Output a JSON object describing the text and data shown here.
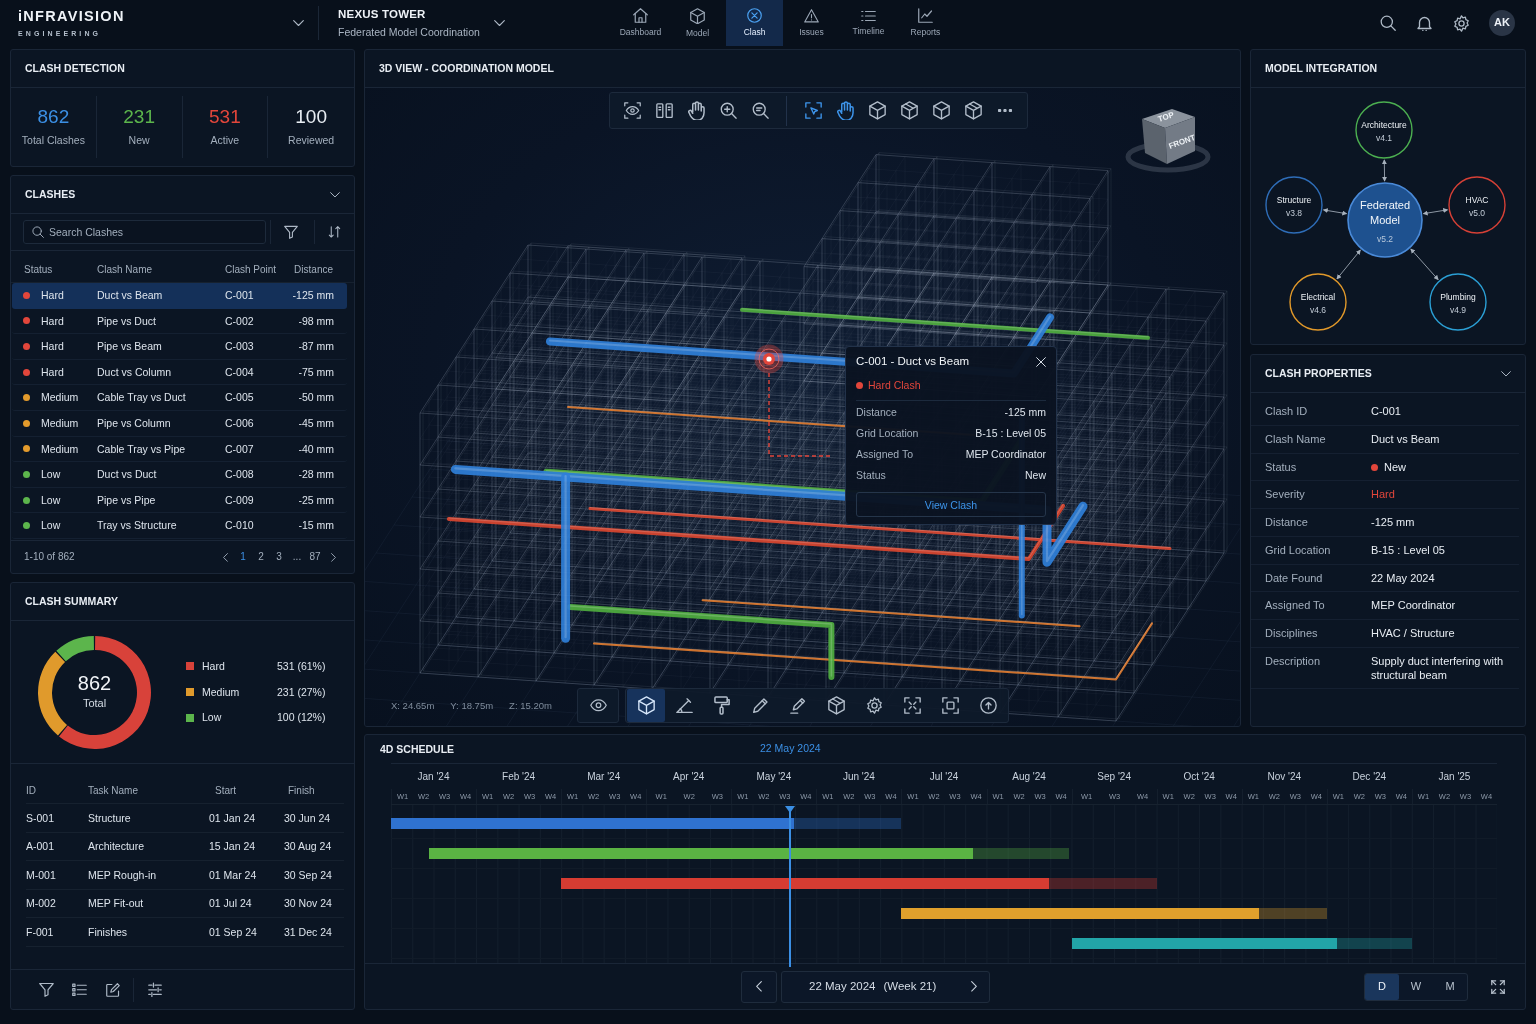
{
  "header": {
    "brand": "iNFRAVISION",
    "tagline": "ENGINEERING",
    "project": {
      "name": "NEXUS TOWER",
      "subtitle": "Federated Model Coordination"
    },
    "nav": [
      {
        "label": "Dashboard",
        "selected": false
      },
      {
        "label": "Model",
        "selected": false
      },
      {
        "label": "Clash",
        "selected": true
      },
      {
        "label": "Issues",
        "selected": false
      },
      {
        "label": "Timeline",
        "selected": false
      },
      {
        "label": "Reports",
        "selected": false
      }
    ],
    "avatar": "AK"
  },
  "clash_detection": {
    "title": "CLASH DETECTION",
    "stats": [
      {
        "value": "862",
        "label": "Total Clashes",
        "color": "#3b8fe4"
      },
      {
        "value": "231",
        "label": "New",
        "color": "#5cb54c"
      },
      {
        "value": "531",
        "label": "Active",
        "color": "#e2463b"
      },
      {
        "value": "100",
        "label": "Reviewed",
        "color": "#e8edf3"
      }
    ]
  },
  "clashes": {
    "title": "CLASHES",
    "search": {
      "placeholder": "Search Clashes"
    },
    "columns": [
      "Status",
      "Clash Name",
      "Clash Point",
      "Distance"
    ],
    "rows": [
      {
        "status": "Hard",
        "color": "#e2463b",
        "name": "Duct vs Beam",
        "point": "C-001",
        "distance": "-125 mm",
        "selected": true
      },
      {
        "status": "Hard",
        "color": "#e2463b",
        "name": "Pipe vs Duct",
        "point": "C-002",
        "distance": "-98 mm",
        "selected": false
      },
      {
        "status": "Hard",
        "color": "#e2463b",
        "name": "Pipe vs Beam",
        "point": "C-003",
        "distance": "-87 mm",
        "selected": false
      },
      {
        "status": "Hard",
        "color": "#e2463b",
        "name": "Duct vs Column",
        "point": "C-004",
        "distance": "-75 mm",
        "selected": false
      },
      {
        "status": "Medium",
        "color": "#e39b2c",
        "name": "Cable Tray vs Duct",
        "point": "C-005",
        "distance": "-50 mm",
        "selected": false
      },
      {
        "status": "Medium",
        "color": "#e39b2c",
        "name": "Pipe vs Column",
        "point": "C-006",
        "distance": "-45 mm",
        "selected": false
      },
      {
        "status": "Medium",
        "color": "#e39b2c",
        "name": "Cable Tray vs Pipe",
        "point": "C-007",
        "distance": "-40 mm",
        "selected": false
      },
      {
        "status": "Low",
        "color": "#5cb54c",
        "name": "Duct vs Duct",
        "point": "C-008",
        "distance": "-28 mm",
        "selected": false
      },
      {
        "status": "Low",
        "color": "#5cb54c",
        "name": "Pipe vs Pipe",
        "point": "C-009",
        "distance": "-25 mm",
        "selected": false
      },
      {
        "status": "Low",
        "color": "#5cb54c",
        "name": "Tray vs Structure",
        "point": "C-010",
        "distance": "-15 mm",
        "selected": false
      }
    ],
    "pagination": {
      "summary": "1-10 of 862",
      "pages": [
        {
          "label": "1",
          "selected": true
        },
        {
          "label": "2",
          "selected": false
        },
        {
          "label": "3",
          "selected": false
        },
        {
          "label": "...",
          "selected": false
        },
        {
          "label": "87",
          "selected": false
        }
      ]
    }
  },
  "clash_summary": {
    "title": "CLASH SUMMARY",
    "total": "862",
    "total_label": "Total",
    "chart_data": {
      "type": "donut",
      "categories": [
        "Hard",
        "Medium",
        "Low"
      ],
      "values": [
        61,
        27,
        12
      ]
    },
    "legend": [
      {
        "value": "531 (61%)",
        "color": "#d8423a"
      },
      {
        "value": "231 (27%)",
        "color": "#e09a2c"
      },
      {
        "value": "100 (12%)",
        "color": "#5cb54c"
      }
    ],
    "tasks": {
      "columns": [
        "ID",
        "Task Name",
        "Start",
        "Finish"
      ],
      "rows": [
        {
          "id": "S-001",
          "name": "Structure",
          "start": "01 Jan 24",
          "finish": "30 Jun 24"
        },
        {
          "id": "A-001",
          "name": "Architecture",
          "start": "15 Jan 24",
          "finish": "30 Aug 24"
        },
        {
          "id": "M-001",
          "name": "MEP Rough-in",
          "start": "01 Mar 24",
          "finish": "30 Sep 24"
        },
        {
          "id": "M-002",
          "name": "MEP Fit-out",
          "start": "01 Jul 24",
          "finish": "30 Nov 24"
        },
        {
          "id": "F-001",
          "name": "Finishes",
          "start": "01 Sep 24",
          "finish": "31 Dec 24"
        }
      ]
    }
  },
  "viewport": {
    "title": "3D VIEW - COORDINATION MODEL",
    "top_tools": [
      {
        "selected": false
      },
      {
        "selected": false
      },
      {
        "selected": false
      },
      {
        "selected": false
      },
      {
        "selected": false
      },
      {
        "selected": true
      },
      {
        "selected": true
      },
      {
        "selected": false
      },
      {
        "selected": false
      },
      {
        "selected": false
      },
      {
        "selected": false
      },
      {
        "selected": false
      }
    ],
    "view_cube": {
      "front": "FRONT",
      "top": "TOP"
    },
    "tooltip": {
      "title": "C-001 - Duct vs Beam",
      "severity": "Hard Clash",
      "color": "#e2463b",
      "rows": [
        {
          "label": "Distance",
          "value": "-125 mm"
        },
        {
          "label": "Grid Location",
          "value": "B-15 : Level 05"
        },
        {
          "label": "Assigned To",
          "value": "MEP Coordinator"
        },
        {
          "label": "Status",
          "value": "New"
        }
      ],
      "button": "View Clash"
    },
    "coordinates": [
      "X: 24.65m",
      "Y: 18.75m",
      "Z: 15.20m"
    ],
    "bottom_tools": [
      {
        "selected": false
      },
      {
        "selected": true
      },
      {
        "selected": false
      },
      {
        "selected": false
      },
      {
        "selected": false
      },
      {
        "selected": false
      },
      {
        "selected": false
      },
      {
        "selected": false
      },
      {
        "selected": false
      },
      {
        "selected": false
      },
      {
        "selected": false
      }
    ]
  },
  "model_integration": {
    "title": "MODEL INTEGRATION",
    "hub": {
      "name": "Federated Model",
      "version": "v5.2",
      "color": "#1e518f"
    },
    "nodes": [
      {
        "name": "Architecture",
        "version": "v4.1",
        "color": "#4caf50"
      },
      {
        "name": "Structure",
        "version": "v3.8",
        "color": "#2e6db8"
      },
      {
        "name": "HVAC",
        "version": "v5.0",
        "color": "#d64036"
      },
      {
        "name": "Electrical",
        "version": "v4.6",
        "color": "#e0982a"
      },
      {
        "name": "Plumbing",
        "version": "v4.9",
        "color": "#2b9fd4"
      }
    ]
  },
  "clash_properties": {
    "title": "CLASH PROPERTIES",
    "rows": [
      {
        "kind": "text",
        "label": "Clash ID",
        "value": "C-001"
      },
      {
        "kind": "text",
        "label": "Clash Name",
        "value": "Duct vs Beam"
      },
      {
        "kind": "status",
        "label": "Status",
        "value": "New",
        "color": "#e2463b"
      },
      {
        "kind": "severity",
        "label": "Severity",
        "value": "Hard",
        "color": "#e2463b"
      },
      {
        "kind": "text",
        "label": "Distance",
        "value": "-125 mm"
      },
      {
        "kind": "text",
        "label": "Grid Location",
        "value": "B-15 : Level 05"
      },
      {
        "kind": "text",
        "label": "Date Found",
        "value": "22 May 2024"
      },
      {
        "kind": "text",
        "label": "Assigned To",
        "value": "MEP Coordinator"
      },
      {
        "kind": "text",
        "label": "Disciplines",
        "value": "HVAC / Structure"
      },
      {
        "kind": "text",
        "label": "Description",
        "value": "Supply duct interfering with structural beam"
      }
    ]
  },
  "schedule": {
    "title": "4D SCHEDULE",
    "today": "22 May 2024",
    "months": [
      {
        "label": "Jan '24",
        "weeks": [
          "W1",
          "W2",
          "W3",
          "W4"
        ]
      },
      {
        "label": "Feb '24",
        "weeks": [
          "W1",
          "W2",
          "W3",
          "W4"
        ]
      },
      {
        "label": "Mar '24",
        "weeks": [
          "W1",
          "W2",
          "W3",
          "W4"
        ]
      },
      {
        "label": "Apr '24",
        "weeks": [
          "W1",
          "W2",
          "W3"
        ]
      },
      {
        "label": "May '24",
        "weeks": [
          "W1",
          "W2",
          "W3",
          "W4"
        ]
      },
      {
        "label": "Jun '24",
        "weeks": [
          "W1",
          "W2",
          "W3",
          "W4"
        ]
      },
      {
        "label": "Jul '24",
        "weeks": [
          "W1",
          "W2",
          "W3",
          "W4"
        ]
      },
      {
        "label": "Aug '24",
        "weeks": [
          "W1",
          "W2",
          "W3",
          "W4"
        ]
      },
      {
        "label": "Sep '24",
        "weeks": [
          "W1",
          "W3",
          "W4"
        ]
      },
      {
        "label": "Oct '24",
        "weeks": [
          "W1",
          "W2",
          "W3",
          "W4"
        ]
      },
      {
        "label": "Nov '24",
        "weeks": [
          "W1",
          "W2",
          "W3",
          "W4"
        ]
      },
      {
        "label": "Dec '24",
        "weeks": [
          "W1",
          "W2",
          "W3",
          "W4"
        ]
      },
      {
        "label": "Jan '25",
        "weeks": [
          "W1",
          "W2",
          "W3",
          "W4"
        ]
      }
    ],
    "bars": [
      {
        "color": "#2f72d0",
        "level": 0.79
      },
      {
        "color": "#5ab343",
        "level": 0.85
      },
      {
        "color": "#d63c32",
        "level": 0.82
      },
      {
        "color": "#e0a02c",
        "level": 0.84
      },
      {
        "color": "#22a5a8",
        "level": 0.78
      }
    ],
    "current_date": "22 May 2024",
    "current_week": "(Week 21)",
    "scales": [
      {
        "label": "D",
        "selected": true
      },
      {
        "label": "W",
        "selected": false
      },
      {
        "label": "M",
        "selected": false
      }
    ]
  }
}
